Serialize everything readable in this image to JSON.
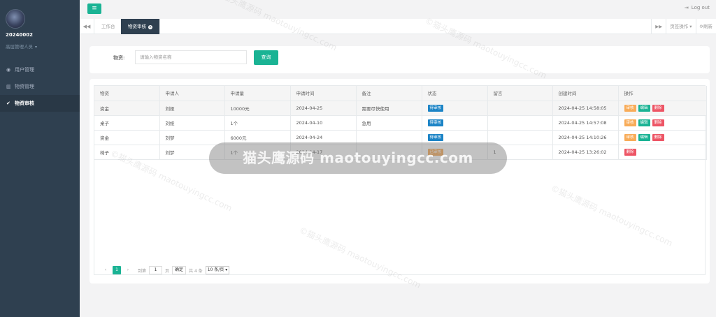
{
  "sidebar": {
    "user_id": "20240002",
    "user_role": "高层管理人员",
    "items": [
      {
        "label": "用户管理",
        "icon": "user-icon",
        "active": false
      },
      {
        "label": "物资管理",
        "icon": "bank-icon",
        "active": false
      },
      {
        "label": "物资审核",
        "icon": "check-circle-icon",
        "active": true
      }
    ]
  },
  "topbar": {
    "menu_icon": "menu-icon",
    "logout_label": "Log out"
  },
  "tabs": {
    "items": [
      {
        "label": "工作台",
        "active": false
      },
      {
        "label": "物资审核",
        "active": true
      }
    ],
    "page_ops_label": "页签操作",
    "refresh_label": "刷新"
  },
  "search": {
    "label": "物资:",
    "placeholder": "请输入物资名称",
    "button_label": "查询"
  },
  "table": {
    "columns": [
      "物资",
      "申请人",
      "申请量",
      "申请时间",
      "备注",
      "状态",
      "留言",
      "创建时间",
      "操作"
    ],
    "rows": [
      {
        "item": "资金",
        "applicant": "刘娅",
        "amount": "10000元",
        "date": "2024-04-25",
        "note": "需要尽快使用",
        "status": "待审核",
        "message": "",
        "created": "2024-04-25 14:58:05",
        "ops": [
          "审核",
          "编辑",
          "删除"
        ]
      },
      {
        "item": "桌子",
        "applicant": "刘娅",
        "amount": "1个",
        "date": "2024-04-10",
        "note": "急用",
        "status": "待审核",
        "message": "",
        "created": "2024-04-25 14:57:08",
        "ops": [
          "审核",
          "编辑",
          "删除"
        ]
      },
      {
        "item": "资金",
        "applicant": "刘梦",
        "amount": "6000元",
        "date": "2024-04-24",
        "note": "",
        "status": "待审核",
        "message": "",
        "created": "2024-04-25 14:10:26",
        "ops": [
          "审核",
          "编辑",
          "删除"
        ]
      },
      {
        "item": "椅子",
        "applicant": "刘梦",
        "amount": "1个",
        "date": "2024-04-17",
        "note": "",
        "status": "已审核",
        "message": "1",
        "created": "2024-04-25 13:26:02",
        "ops": [
          "删除"
        ]
      }
    ]
  },
  "pager": {
    "current_page": "1",
    "goto_label": "到第",
    "goto_value": "1",
    "page_unit": "页",
    "confirm_label": "确定",
    "total_label": "共 4 条",
    "page_size_label": "10 条/页"
  },
  "overlay": {
    "text": "猫头鹰源码 maotouyingcc.com"
  },
  "watermark": {
    "line1": "©猫头鹰源码",
    "line2": "maotouyingcc.com"
  },
  "colors": {
    "sidebar_bg": "#2f4050",
    "accent": "#1ab394",
    "pending": "#1c84c6",
    "warning": "#f8ac59",
    "danger": "#ed5565"
  }
}
